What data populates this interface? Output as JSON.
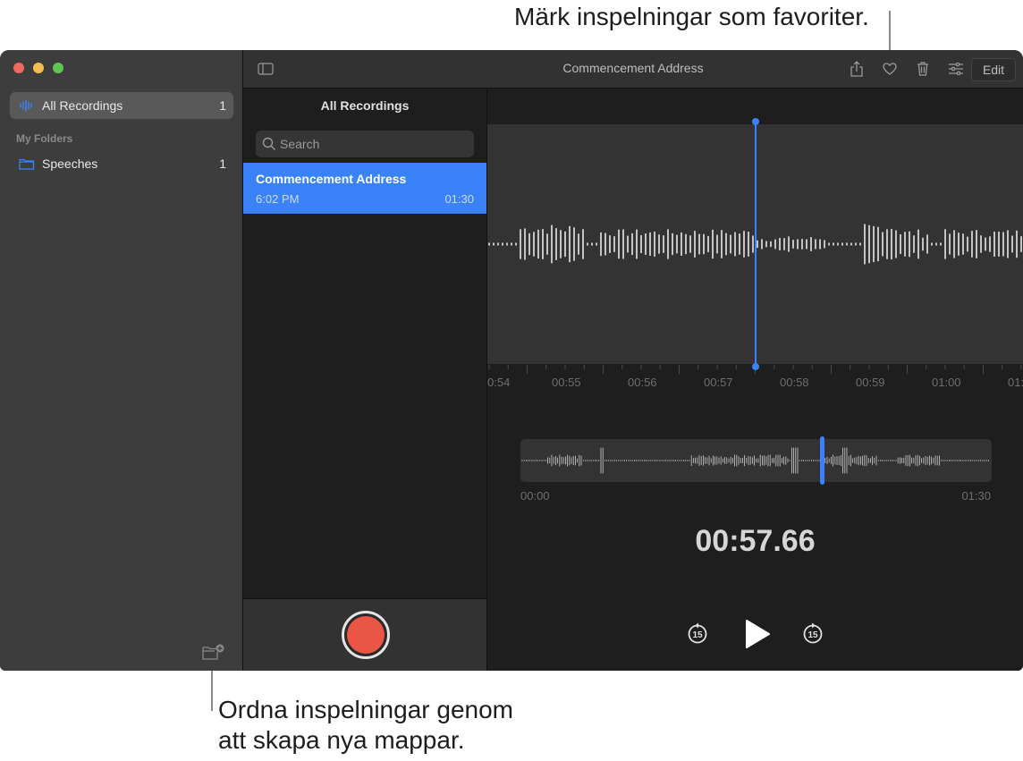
{
  "callouts": {
    "favorites": "Märk inspelningar som favoriter.",
    "folders_line1": "Ordna inspelningar genom",
    "folders_line2": "att skapa nya mappar."
  },
  "window": {
    "title": "Commencement Address",
    "traffic_lights": {
      "close": "#ed6a5e",
      "minimize": "#f5bf4f",
      "zoom": "#61c554"
    }
  },
  "sidebar": {
    "items": [
      {
        "label": "All Recordings",
        "count": "1",
        "icon": "waveform-icon",
        "selected": true
      }
    ],
    "section_header": "My Folders",
    "folders": [
      {
        "label": "Speeches",
        "count": "1",
        "icon": "folder-icon"
      }
    ],
    "new_folder_icon": "new-folder-icon"
  },
  "toolbar": {
    "sidebar_toggle_icon": "sidebar-toggle-icon",
    "share_icon": "share-icon",
    "favorite_icon": "heart-icon",
    "delete_icon": "trash-icon",
    "settings_icon": "sliders-icon",
    "edit_label": "Edit"
  },
  "list": {
    "title": "All Recordings",
    "search_placeholder": "Search",
    "recordings": [
      {
        "name": "Commencement Address",
        "time": "6:02 PM",
        "duration": "01:30",
        "selected": true
      }
    ]
  },
  "detail": {
    "timeline_ticks": [
      "0:54",
      "00:55",
      "00:56",
      "00:57",
      "00:58",
      "00:59",
      "01:00",
      "01:"
    ],
    "overview_start": "00:00",
    "overview_end": "01:30",
    "current_time": "00:57.66",
    "playhead_fraction": 0.64,
    "skip_back_label": "15",
    "skip_forward_label": "15"
  },
  "colors": {
    "accent": "#3a82f7",
    "record": "#eb5545"
  }
}
